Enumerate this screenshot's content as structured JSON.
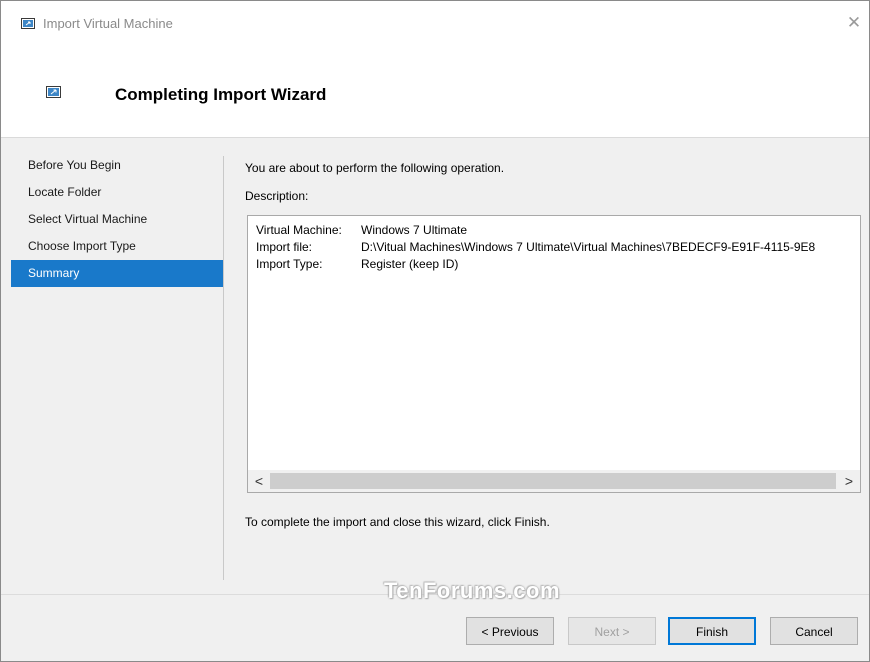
{
  "window": {
    "title": "Import Virtual Machine",
    "close_glyph": "✕",
    "title_icon": "vm-import-icon"
  },
  "header": {
    "title": "Completing Import Wizard",
    "icon": "vm-import-icon"
  },
  "nav": {
    "items": [
      {
        "label": "Before You Begin",
        "selected": false
      },
      {
        "label": "Locate Folder",
        "selected": false
      },
      {
        "label": "Select Virtual Machine",
        "selected": false
      },
      {
        "label": "Choose Import Type",
        "selected": false
      },
      {
        "label": "Summary",
        "selected": true
      }
    ]
  },
  "content": {
    "intro": "You are about to perform the following operation.",
    "description_label": "Description:",
    "summary": [
      {
        "key": "Virtual Machine:",
        "value": "Windows 7 Ultimate"
      },
      {
        "key": "Import file:",
        "value": "D:\\Vitual Machines\\Windows 7 Ultimate\\Virtual Machines\\7BEDECF9-E91F-4115-9E8"
      },
      {
        "key": "Import Type:",
        "value": "Register (keep ID)"
      }
    ],
    "scroll_left_glyph": "<",
    "scroll_right_glyph": ">",
    "complete_text": "To complete the import and close this wizard, click Finish."
  },
  "watermark": "TenForums.com",
  "buttons": {
    "previous": "< Previous",
    "next": "Next >",
    "finish": "Finish",
    "cancel": "Cancel"
  },
  "colors": {
    "accent": "#1979ca",
    "default_button_border": "#0078d7"
  }
}
